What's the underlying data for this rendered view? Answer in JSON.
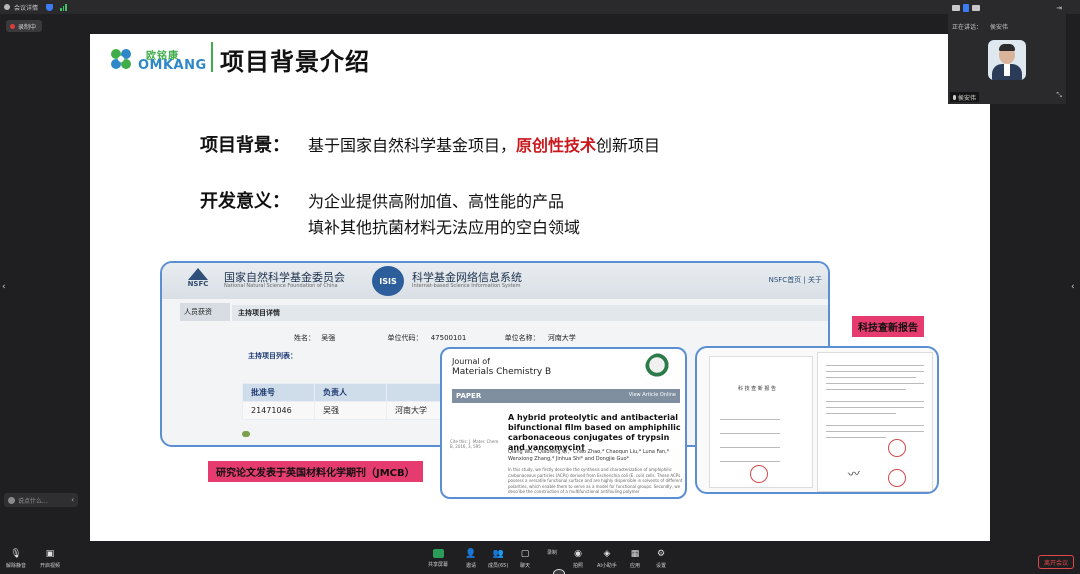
{
  "window": {
    "title": "会议详情"
  },
  "recording": {
    "label": "录制中"
  },
  "chat": {
    "placeholder": "说点什么..."
  },
  "slide": {
    "logo": {
      "cn": "欧铭康",
      "en": "OMKANG"
    },
    "title": "项目背景介绍",
    "background_label": "项目背景：",
    "background_text_before": "基于国家自然科学基金项目，",
    "background_highlight": "原创性技术",
    "background_text_after": "创新项目",
    "significance_label": "开发意义：",
    "significance_line1": "为企业提供高附加值、高性能的产品",
    "significance_line2": "填补其他抗菌材料无法应用的空白领域",
    "nsfc": {
      "org_cn": "国家自然科学基金委员会",
      "org_en": "National Natural Science Foundation of China",
      "logo_text": "NSFC",
      "isis_text": "ISIS",
      "system_cn": "科学基金网络信息系统",
      "system_en": "Internet-based Science Information System",
      "nav": "NSFC首页 | 关于",
      "left_tab": "人员获资",
      "panel_title": "主持项目详情",
      "name_label": "姓名：",
      "name_value": "吴强",
      "unit_code_label": "单位代码：",
      "unit_code_value": "47500101",
      "unit_name_label": "单位名称：",
      "unit_name_value": "河南大学",
      "list_title": "主持项目列表：",
      "table_headers": [
        "批准号",
        "负责人",
        ""
      ],
      "table_rows": [
        [
          "21471046",
          "吴强",
          "河南大学"
        ]
      ]
    },
    "paper": {
      "journal_line1": "Journal of",
      "journal_line2": "Materials Chemistry B",
      "section": "PAPER",
      "view_online": "View Article Online",
      "article_title": "A hybrid proteolytic and antibacterial bifunctional film based on amphiphilic carbonaceous conjugates of trypsin and vancomycin†",
      "authors": "Qiang Wu,* Qiaofeng Qi,* Chao Zhao,* Chaoqun Liu,* Luna Fan,* Wenxiong Zhang,* Jinhua Shi* and Dongjie Guo*",
      "cite": "Cite this: J. Mater. Chem. B, 2016, 3, 595",
      "abstract": "In this study, we firstly describe the synthesis and characterization of amphiphilic carbonaceous particles (ACPs) derived from Escherichia coli (E. coli) cells. These ACPs possess a versatile functional surface and are highly dispersible in solvents of different polarities, which enable them to serve as a model for functional groups. Secondly, we describe the construction of a multifunctional antifouling polymer"
    },
    "report": {
      "page_title": "科 技 查 新 报 告"
    },
    "label_report": "科技查新报告",
    "label_jmcb": "研究论文发表于英国材料化学期刊（JMCB）"
  },
  "video": {
    "speaking_label": "正在讲话：",
    "speaker_name": "侯安伟",
    "tile_name": "侯安伟"
  },
  "toolbar": {
    "items": [
      {
        "label": "解除静音",
        "icon": "mic-icon"
      },
      {
        "label": "开启视频",
        "icon": "camera-icon"
      },
      {
        "label": "共享屏幕",
        "icon": "share-screen-icon"
      },
      {
        "label": "邀请",
        "icon": "invite-icon"
      },
      {
        "label": "成员(65)",
        "icon": "members-icon"
      },
      {
        "label": "聊天",
        "icon": "chat-icon"
      },
      {
        "label": "录制",
        "icon": "record-icon"
      },
      {
        "label": "拍照",
        "icon": "camera-snap-icon"
      },
      {
        "label": "AI小助手",
        "icon": "ai-assistant-icon"
      },
      {
        "label": "应用",
        "icon": "apps-icon"
      },
      {
        "label": "设置",
        "icon": "settings-icon"
      }
    ],
    "leave_label": "离开会议"
  },
  "colors": {
    "accent_red": "#c8191e",
    "label_pink": "#e63b6f",
    "card_border": "#5a8fd2",
    "logo_green": "#3fae49",
    "logo_blue": "#2d87c8",
    "share_green": "#2a9d59",
    "leave_red": "#e04848"
  }
}
